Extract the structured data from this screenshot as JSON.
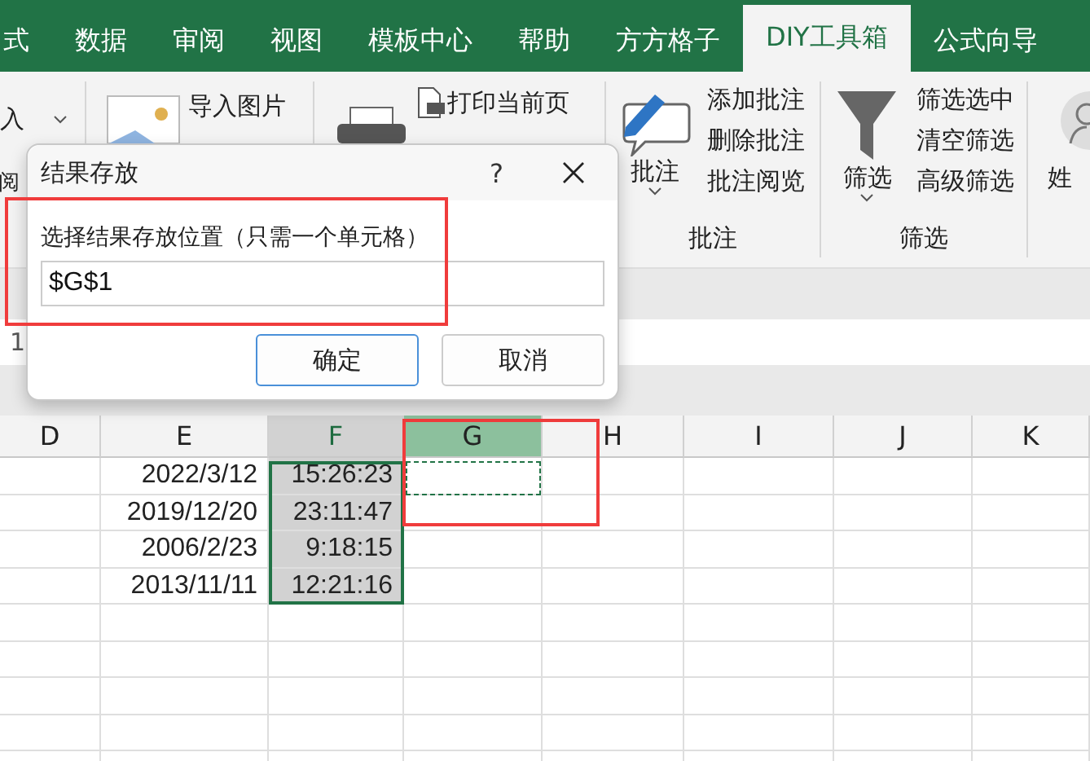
{
  "tabs": [
    {
      "label": "式",
      "selected": false
    },
    {
      "label": "数据",
      "selected": false
    },
    {
      "label": "审阅",
      "selected": false
    },
    {
      "label": "视图",
      "selected": false
    },
    {
      "label": "模板中心",
      "selected": false
    },
    {
      "label": "帮助",
      "selected": false
    },
    {
      "label": "方方格子",
      "selected": false
    },
    {
      "label": "DIY工具箱",
      "selected": true
    },
    {
      "label": "公式向导",
      "selected": false
    }
  ],
  "ribbon": {
    "insert_partial": "入",
    "review_partial": "阅",
    "import_picture": "导入图片",
    "print_page": "打印当前页",
    "groups": [
      {
        "kind": "comment",
        "button": "批注",
        "items": [
          "添加批注",
          "删除批注",
          "批注阅览"
        ],
        "label": "批注"
      },
      {
        "kind": "filter",
        "button": "筛选",
        "items": [
          "筛选选中",
          "清空筛选",
          "高级筛选"
        ],
        "label": "筛选"
      }
    ],
    "avatar_label": "姓"
  },
  "name_box_partial": "1",
  "dialog": {
    "title": "结果存放",
    "help": "?",
    "prompt": "选择结果存放位置（只需一个单元格）",
    "value": "$G$1",
    "buttons": [
      {
        "label": "确定",
        "default": true
      },
      {
        "label": "取消",
        "default": false
      }
    ]
  },
  "sheet": {
    "columns": [
      {
        "label": "D",
        "selected": false,
        "active": false
      },
      {
        "label": "E",
        "selected": false,
        "active": false
      },
      {
        "label": "F",
        "selected": true,
        "active": false
      },
      {
        "label": "G",
        "selected": false,
        "active": true
      },
      {
        "label": "H",
        "selected": false,
        "active": false
      },
      {
        "label": "I",
        "selected": false,
        "active": false
      },
      {
        "label": "J",
        "selected": false,
        "active": false
      },
      {
        "label": "K",
        "selected": false,
        "active": false
      }
    ],
    "rows": [
      [
        "",
        "2022/3/12",
        "15:26:23"
      ],
      [
        "",
        "2019/12/20",
        "23:11:47"
      ],
      [
        "",
        "2006/2/23",
        "9:18:15"
      ],
      [
        "",
        "2013/11/11",
        "12:21:16"
      ]
    ]
  }
}
